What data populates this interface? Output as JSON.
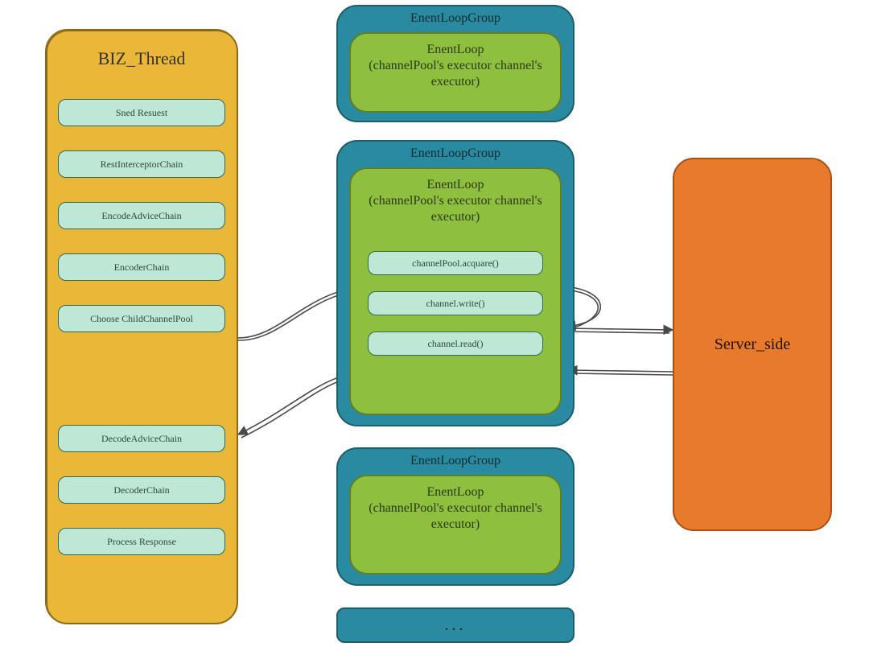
{
  "biz": {
    "title": "BIZ_Thread",
    "steps": [
      "Sned Resuest",
      "RestInterceptorChain",
      "EncodeAdviceChain",
      "EncoderChain",
      "Choose ChildChannelPool",
      "DecodeAdviceChain",
      "DecoderChain",
      "Process Response"
    ]
  },
  "loopGroupTitle": "EnentLoopGroup",
  "loopTitle": "EnentLoop",
  "loopSubtitle": "(channelPool's executor channel's executor)",
  "ops": {
    "acquire": "channelPool.acquare()",
    "write": "channel.write()",
    "read": "channel.read()"
  },
  "server": "Server_side",
  "more": "..."
}
